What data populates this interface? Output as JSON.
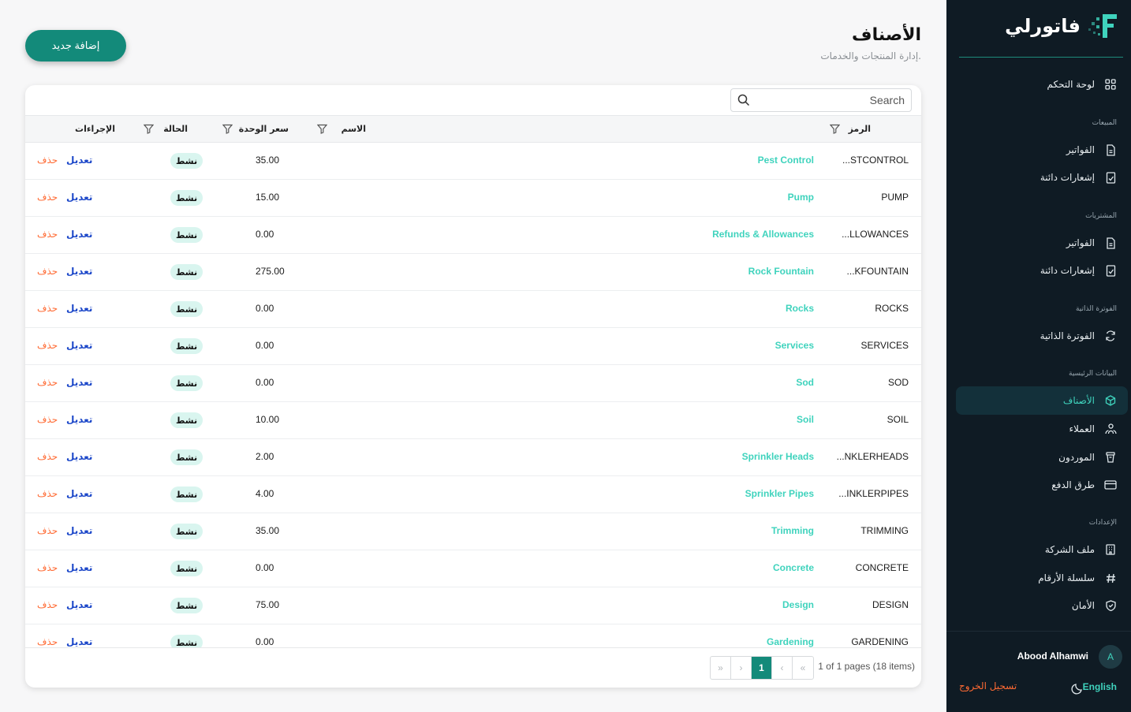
{
  "brand": {
    "name": "فاتورلي"
  },
  "header": {
    "title": "الأصناف",
    "subtitle": "إدارة المنتجات والخدمات.",
    "add_label": "إضافة جديد"
  },
  "search": {
    "placeholder": "Search"
  },
  "columns": {
    "code": "الرمز",
    "name": "الاسم",
    "price": "سعر الوحدة",
    "status": "الحالة",
    "actions": "الإجراءات"
  },
  "rows": [
    {
      "code": "...STCONTROL",
      "name": "Pest Control",
      "price": "35.00",
      "status": "نشط"
    },
    {
      "code": "PUMP",
      "name": "Pump",
      "price": "15.00",
      "status": "نشط"
    },
    {
      "code": "...LLOWANCES",
      "name": "Refunds & Allowances",
      "price": "0.00",
      "status": "نشط"
    },
    {
      "code": "...KFOUNTAIN",
      "name": "Rock Fountain",
      "price": "275.00",
      "status": "نشط"
    },
    {
      "code": "ROCKS",
      "name": "Rocks",
      "price": "0.00",
      "status": "نشط"
    },
    {
      "code": "SERVICES",
      "name": "Services",
      "price": "0.00",
      "status": "نشط"
    },
    {
      "code": "SOD",
      "name": "Sod",
      "price": "0.00",
      "status": "نشط"
    },
    {
      "code": "SOIL",
      "name": "Soil",
      "price": "10.00",
      "status": "نشط"
    },
    {
      "code": "...NKLERHEADS",
      "name": "Sprinkler Heads",
      "price": "2.00",
      "status": "نشط"
    },
    {
      "code": "...INKLERPIPES",
      "name": "Sprinkler Pipes",
      "price": "4.00",
      "status": "نشط"
    },
    {
      "code": "TRIMMING",
      "name": "Trimming",
      "price": "35.00",
      "status": "نشط"
    },
    {
      "code": "CONCRETE",
      "name": "Concrete",
      "price": "0.00",
      "status": "نشط"
    },
    {
      "code": "DESIGN",
      "name": "Design",
      "price": "75.00",
      "status": "نشط"
    },
    {
      "code": "GARDENING",
      "name": "Gardening",
      "price": "0.00",
      "status": "نشط"
    }
  ],
  "actions": {
    "edit": "تعديل",
    "delete": "حذف"
  },
  "pagination": {
    "info": "1 of 1 pages (18 items)",
    "current": "1",
    "first": "«",
    "prev": "‹",
    "next": "›",
    "last": "»"
  },
  "sidebar": {
    "dashboard": "لوحة التحكم",
    "sections": {
      "sales": "المبيعات",
      "purchases": "المشتريات",
      "self_billing": "الفوترة الذاتية",
      "master_data": "البيانات الرئيسية",
      "settings": "الإعدادات"
    },
    "items": {
      "sales_invoices": "الفواتير",
      "sales_credit_notes": "إشعارات دائنة",
      "purchase_invoices": "الفواتير",
      "purchase_credit_notes": "إشعارات دائنة",
      "self_billing": "الفوترة الذاتية",
      "products": "الأصناف",
      "customers": "العملاء",
      "suppliers": "الموردون",
      "payment_methods": "طرق الدفع",
      "company_profile": "ملف الشركة",
      "number_series": "سلسلة الأرقام",
      "security": "الأمان"
    },
    "user": {
      "initial": "A",
      "name": "Abood Alhamwi"
    },
    "logout": "تسجيل الخروج",
    "language": "English"
  },
  "colors": {
    "accent": "#138a7a",
    "teal": "#3fd3bd",
    "sidebar_bg": "#0f1b24",
    "delete": "#ff6a33",
    "edit": "#1d48c9"
  },
  "icons": [
    "grid-icon",
    "document-icon",
    "receipt-icon",
    "refresh-icon",
    "box-icon",
    "users-icon",
    "bin-icon",
    "card-icon",
    "building-icon",
    "hash-icon",
    "shield-icon",
    "moon-icon",
    "search-icon",
    "filter-icon"
  ]
}
